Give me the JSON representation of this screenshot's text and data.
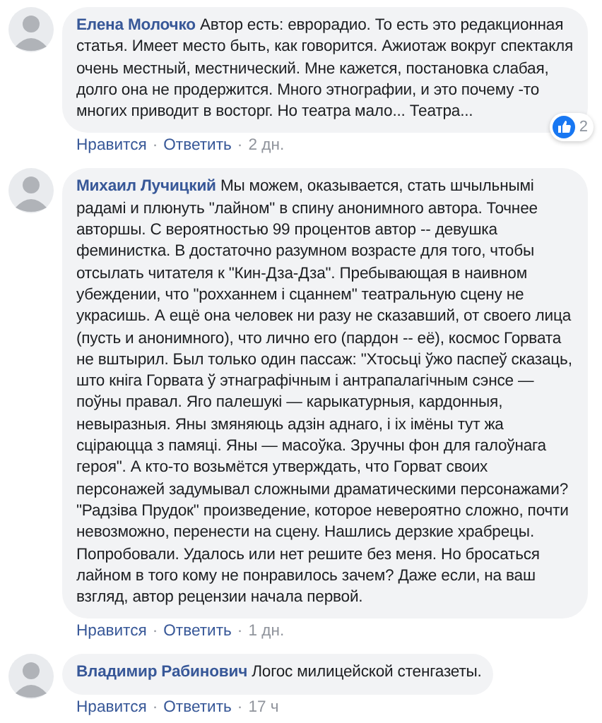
{
  "comments": [
    {
      "author": "Елена Молочко",
      "text": "Автор есть: еврорадио. То есть это редакционная статья. Имеет место быть, как говорится. Ажиотаж вокруг спектакля очень местный, местнический. Мне кажется, постановка слабая, долго она не продержится. Много этнографии, и это почему -то многих приводит в восторг. Но театра мало... Театра...",
      "reaction": {
        "count": "2"
      },
      "actions": [
        {
          "kind": "link",
          "label": "Нравится"
        },
        {
          "kind": "separator",
          "label": "·"
        },
        {
          "kind": "link",
          "label": "Ответить"
        },
        {
          "kind": "separator",
          "label": "·"
        },
        {
          "kind": "time",
          "label": "2 дн."
        }
      ]
    },
    {
      "author": "Михаил Лучицкий",
      "text": "Мы можем, оказывается, стать шчыльнымі радамі и плюнуть \"лайном\" в спину анонимного автора. Точнее авторшы. С вероятностью 99 процентов автор -- девушка феминистка. В достаточно разумном возрасте для того, чтобы отсылать читателя к \"Кин-Дза-Дза\". Пребывающая в наивном убеждении, что \"рохханнем і сцаннем\" театральную сцену не украсишь. А ещё она человек ни разу не сказавший, от своего лица (пусть и анонимного), что лично его (пардон -- её), космос Горвата не вштырил. Был только один пассаж: \"Хтосьці ўжо паспеў сказаць, што кніга Горвата ў этнаграфічным і антрапалагічным сэнсе — поўны правал. Яго палешукі — карыкатурныя, кардонныя, невыразныя. Яны змяняюць адзін аднаго, і іх імёны тут жа сціраюцца з памяці. Яны — масоўка. Зручны фон для галоўнага героя\". А кто-то возьмётся утверждать, что Горват своих персонажей задумывал сложными драматическими персонажами? \"Радзіва Прудок\" произведение, которое невероятно сложно, почти невозможно, перенести на сцену. Нашлись дерзкие храбрецы. Попробовали. Удалось или нет решите без меня. Но бросаться лайном в того кому не понравилось зачем? Даже если, на ваш взгляд, автор рецензии начала первой.",
      "actions": [
        {
          "kind": "link",
          "label": "Нравится"
        },
        {
          "kind": "separator",
          "label": "·"
        },
        {
          "kind": "link",
          "label": "Ответить"
        },
        {
          "kind": "separator",
          "label": "·"
        },
        {
          "kind": "time",
          "label": "1 дн."
        }
      ]
    },
    {
      "author": "Владимир Рабинович",
      "text": "Логос милицейской стенгазеты.",
      "actions": [
        {
          "kind": "link",
          "label": "Нравится"
        },
        {
          "kind": "separator",
          "label": "·"
        },
        {
          "kind": "link",
          "label": "Ответить"
        },
        {
          "kind": "separator",
          "label": "·"
        },
        {
          "kind": "time",
          "label": "17 ч"
        }
      ]
    }
  ]
}
